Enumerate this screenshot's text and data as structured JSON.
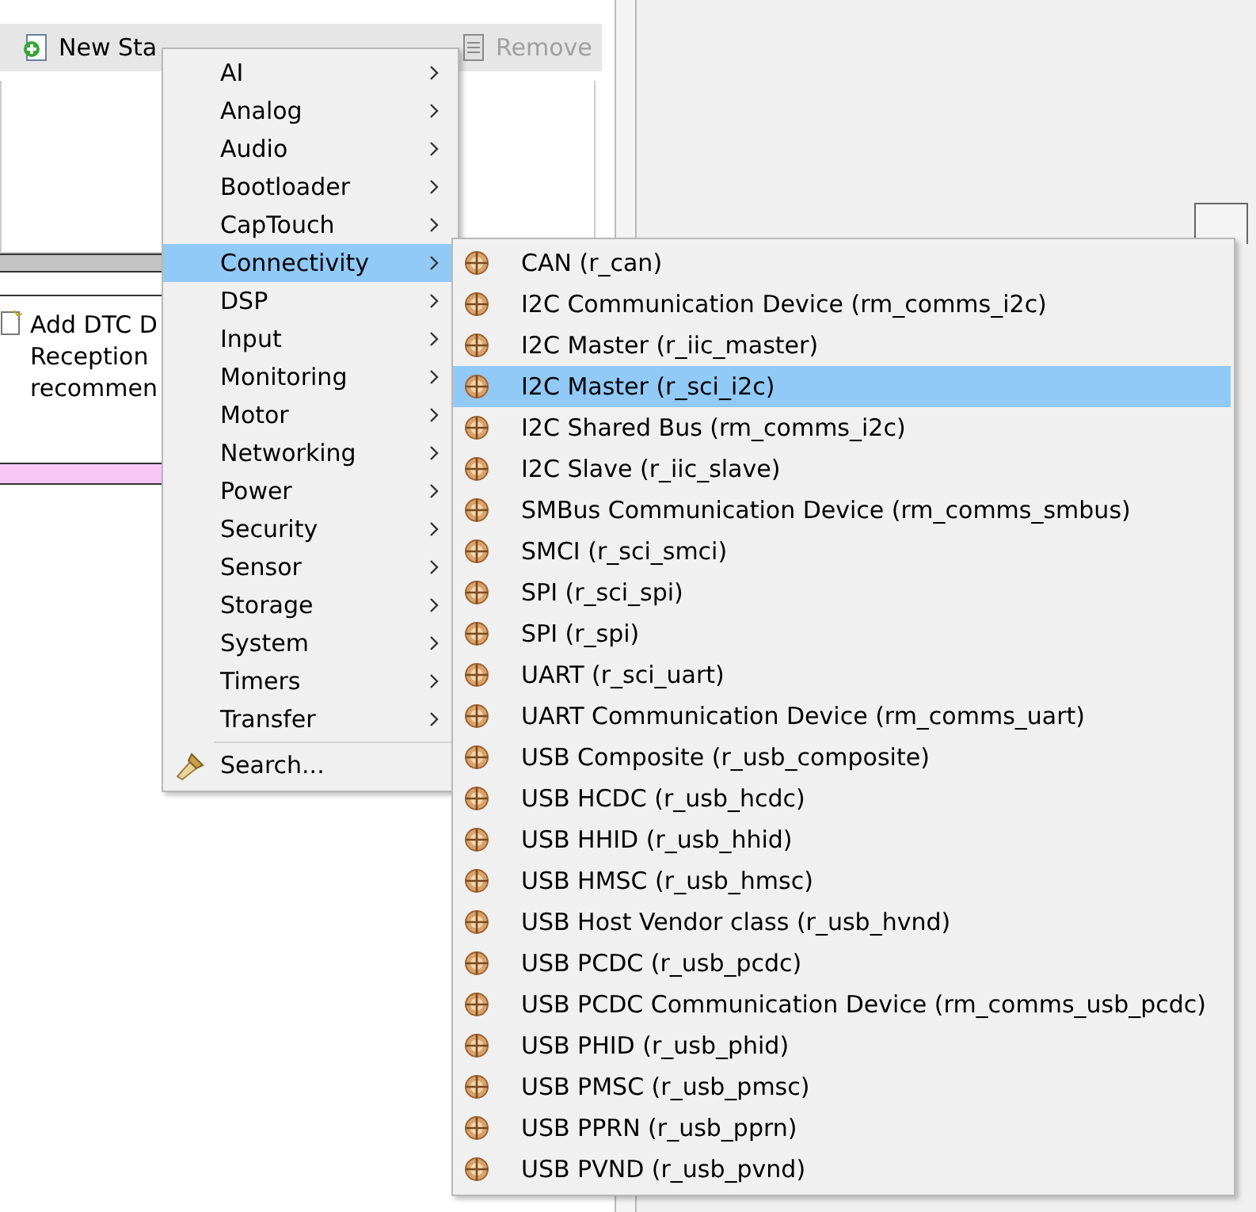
{
  "toolbar": {
    "buttons": [
      {
        "label": "New Sta",
        "disabled": false
      },
      {
        "label": "Remove",
        "disabled": true
      }
    ]
  },
  "panel": {
    "lines": [
      "Add DTC D",
      "Reception",
      "recommen"
    ]
  },
  "menu": {
    "items": [
      {
        "kind": "submenu",
        "label": "AI",
        "selected": false
      },
      {
        "kind": "submenu",
        "label": "Analog",
        "selected": false
      },
      {
        "kind": "submenu",
        "label": "Audio",
        "selected": false
      },
      {
        "kind": "submenu",
        "label": "Bootloader",
        "selected": false
      },
      {
        "kind": "submenu",
        "label": "CapTouch",
        "selected": false
      },
      {
        "kind": "submenu",
        "label": "Connectivity",
        "selected": true
      },
      {
        "kind": "submenu",
        "label": "DSP",
        "selected": false
      },
      {
        "kind": "submenu",
        "label": "Input",
        "selected": false
      },
      {
        "kind": "submenu",
        "label": "Monitoring",
        "selected": false
      },
      {
        "kind": "submenu",
        "label": "Motor",
        "selected": false
      },
      {
        "kind": "submenu",
        "label": "Networking",
        "selected": false
      },
      {
        "kind": "submenu",
        "label": "Power",
        "selected": false
      },
      {
        "kind": "submenu",
        "label": "Security",
        "selected": false
      },
      {
        "kind": "submenu",
        "label": "Sensor",
        "selected": false
      },
      {
        "kind": "submenu",
        "label": "Storage",
        "selected": false
      },
      {
        "kind": "submenu",
        "label": "System",
        "selected": false
      },
      {
        "kind": "submenu",
        "label": "Timers",
        "selected": false
      },
      {
        "kind": "submenu",
        "label": "Transfer",
        "selected": false
      },
      {
        "kind": "search",
        "label": "Search...",
        "selected": false
      }
    ]
  },
  "submenu": {
    "items": [
      {
        "label": "CAN (r_can)",
        "selected": false
      },
      {
        "label": "I2C Communication Device (rm_comms_i2c)",
        "selected": false
      },
      {
        "label": "I2C Master (r_iic_master)",
        "selected": false
      },
      {
        "label": "I2C Master (r_sci_i2c)",
        "selected": true
      },
      {
        "label": "I2C Shared Bus (rm_comms_i2c)",
        "selected": false
      },
      {
        "label": "I2C Slave (r_iic_slave)",
        "selected": false
      },
      {
        "label": "SMBus Communication Device (rm_comms_smbus)",
        "selected": false
      },
      {
        "label": "SMCI (r_sci_smci)",
        "selected": false
      },
      {
        "label": "SPI (r_sci_spi)",
        "selected": false
      },
      {
        "label": "SPI (r_spi)",
        "selected": false
      },
      {
        "label": "UART (r_sci_uart)",
        "selected": false
      },
      {
        "label": "UART Communication Device (rm_comms_uart)",
        "selected": false
      },
      {
        "label": "USB Composite (r_usb_composite)",
        "selected": false
      },
      {
        "label": "USB HCDC (r_usb_hcdc)",
        "selected": false
      },
      {
        "label": "USB HHID (r_usb_hhid)",
        "selected": false
      },
      {
        "label": "USB HMSC (r_usb_hmsc)",
        "selected": false
      },
      {
        "label": "USB Host Vendor class (r_usb_hvnd)",
        "selected": false
      },
      {
        "label": "USB PCDC (r_usb_pcdc)",
        "selected": false
      },
      {
        "label": "USB PCDC Communication Device (rm_comms_usb_pcdc)",
        "selected": false
      },
      {
        "label": "USB PHID (r_usb_phid)",
        "selected": false
      },
      {
        "label": "USB PMSC (r_usb_pmsc)",
        "selected": false
      },
      {
        "label": "USB PPRN (r_usb_pprn)",
        "selected": false
      },
      {
        "label": "USB PVND (r_usb_pvnd)",
        "selected": false
      }
    ]
  }
}
